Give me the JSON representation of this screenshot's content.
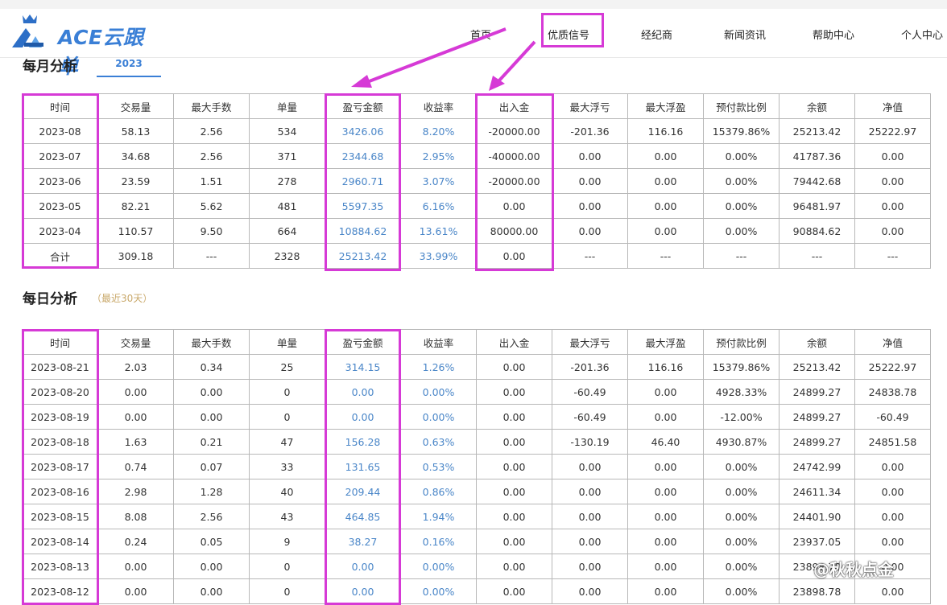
{
  "brand": {
    "logo_text": "ACE云跟单"
  },
  "nav": {
    "items": [
      {
        "label": "首页"
      },
      {
        "label": "优质信号"
      },
      {
        "label": "经纪商"
      },
      {
        "label": "新闻资讯"
      },
      {
        "label": "帮助中心"
      },
      {
        "label": "个人中心"
      }
    ]
  },
  "monthly": {
    "title": "每月分析",
    "year_tab": "2023",
    "columns": [
      "时间",
      "交易量",
      "最大手数",
      "单量",
      "盈亏金额",
      "收益率",
      "出入金",
      "最大浮亏",
      "最大浮盈",
      "预付款比例",
      "余额",
      "净值"
    ],
    "rows": [
      [
        "2023-08",
        "58.13",
        "2.56",
        "534",
        "3426.06",
        "8.20%",
        "-20000.00",
        "-201.36",
        "116.16",
        "15379.86%",
        "25213.42",
        "25222.97"
      ],
      [
        "2023-07",
        "34.68",
        "2.56",
        "371",
        "2344.68",
        "2.95%",
        "-40000.00",
        "0.00",
        "0.00",
        "0.00%",
        "41787.36",
        "0.00"
      ],
      [
        "2023-06",
        "23.59",
        "1.51",
        "278",
        "2960.71",
        "3.07%",
        "-20000.00",
        "0.00",
        "0.00",
        "0.00%",
        "79442.68",
        "0.00"
      ],
      [
        "2023-05",
        "82.21",
        "5.62",
        "481",
        "5597.35",
        "6.16%",
        "0.00",
        "0.00",
        "0.00",
        "0.00%",
        "96481.97",
        "0.00"
      ],
      [
        "2023-04",
        "110.57",
        "9.50",
        "664",
        "10884.62",
        "13.61%",
        "80000.00",
        "0.00",
        "0.00",
        "0.00%",
        "90884.62",
        "0.00"
      ],
      [
        "合计",
        "309.18",
        "---",
        "2328",
        "25213.42",
        "33.99%",
        "0.00",
        "---",
        "---",
        "---",
        "---",
        "---"
      ]
    ]
  },
  "daily": {
    "title": "每日分析",
    "subtitle": "（最近30天）",
    "columns": [
      "时间",
      "交易量",
      "最大手数",
      "单量",
      "盈亏金额",
      "收益率",
      "出入金",
      "最大浮亏",
      "最大浮盈",
      "预付款比例",
      "余额",
      "净值"
    ],
    "rows": [
      [
        "2023-08-21",
        "2.03",
        "0.34",
        "25",
        "314.15",
        "1.26%",
        "0.00",
        "-201.36",
        "116.16",
        "15379.86%",
        "25213.42",
        "25222.97"
      ],
      [
        "2023-08-20",
        "0.00",
        "0.00",
        "0",
        "0.00",
        "0.00%",
        "0.00",
        "-60.49",
        "0.00",
        "4928.33%",
        "24899.27",
        "24838.78"
      ],
      [
        "2023-08-19",
        "0.00",
        "0.00",
        "0",
        "0.00",
        "0.00%",
        "0.00",
        "-60.49",
        "0.00",
        "-12.00%",
        "24899.27",
        "-60.49"
      ],
      [
        "2023-08-18",
        "1.63",
        "0.21",
        "47",
        "156.28",
        "0.63%",
        "0.00",
        "-130.19",
        "46.40",
        "4930.87%",
        "24899.27",
        "24851.58"
      ],
      [
        "2023-08-17",
        "0.74",
        "0.07",
        "33",
        "131.65",
        "0.53%",
        "0.00",
        "0.00",
        "0.00",
        "0.00%",
        "24742.99",
        "0.00"
      ],
      [
        "2023-08-16",
        "2.98",
        "1.28",
        "40",
        "209.44",
        "0.86%",
        "0.00",
        "0.00",
        "0.00",
        "0.00%",
        "24611.34",
        "0.00"
      ],
      [
        "2023-08-15",
        "8.08",
        "2.56",
        "43",
        "464.85",
        "1.94%",
        "0.00",
        "0.00",
        "0.00",
        "0.00%",
        "24401.90",
        "0.00"
      ],
      [
        "2023-08-14",
        "0.24",
        "0.05",
        "9",
        "38.27",
        "0.16%",
        "0.00",
        "0.00",
        "0.00",
        "0.00%",
        "23937.05",
        "0.00"
      ],
      [
        "2023-08-13",
        "0.00",
        "0.00",
        "0",
        "0.00",
        "0.00%",
        "0.00",
        "0.00",
        "0.00",
        "0.00%",
        "23898.78",
        "0.00"
      ],
      [
        "2023-08-12",
        "0.00",
        "0.00",
        "0",
        "0.00",
        "0.00%",
        "0.00",
        "0.00",
        "0.00",
        "0.00%",
        "23898.78",
        "0.00"
      ]
    ]
  },
  "watermark": {
    "text": "@秋秋点金"
  },
  "colors": {
    "accent": "#3a7fd6",
    "highlight": "#d63ad6",
    "value_blue": "#4a86c8",
    "subtitle_gold": "#c9a86a"
  }
}
